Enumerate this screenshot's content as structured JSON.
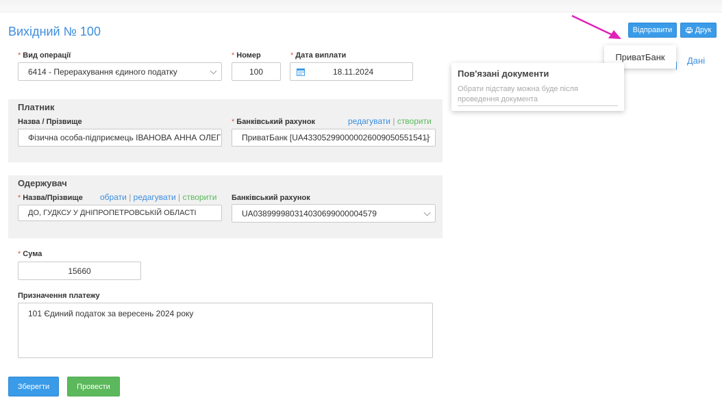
{
  "title": "Вихідний № 100",
  "header_buttons": {
    "send_label": "Відправити",
    "print_label": "Друк"
  },
  "send_dropdown": {
    "items": [
      "ПриватБанк"
    ]
  },
  "tab_link": "Дані",
  "related_docs": {
    "title": "Пов'язані документи",
    "hint": "Обрати підставу можна буде після проведення документа"
  },
  "operation": {
    "label": "Вид операції",
    "value": "6414 - Перерахування єдиного податку"
  },
  "number": {
    "label": "Номер",
    "value": "100"
  },
  "pay_date": {
    "label": "Дата виплати",
    "value": "18.11.2024"
  },
  "payer": {
    "section_title": "Платник",
    "name_label": "Назва / Прізвище",
    "name_value": "Фізична особа-підприємець ІВАНОВА АННА ОЛЕГІВНА",
    "account_label": "Банківський рахунок",
    "account_value": "ПриватБанк [UA433052990000026009050551541]",
    "edit_link": "редагувати",
    "separator": "|",
    "create_link": "створити"
  },
  "recipient": {
    "section_title": "Одержувач",
    "name_label": "Назва/Прізвище",
    "name_value": "ДО, ГУДКСУ У ДНІПРОПЕТРОВСЬКІЙ ОБЛАСТІ",
    "select_link": "обрати",
    "edit_link": "редагувати",
    "create_link": "створити",
    "separator": "|",
    "account_label": "Банківський рахунок",
    "account_value": "UA038999980314030699000004579"
  },
  "sum": {
    "label": "Сума",
    "value": "15660"
  },
  "purpose": {
    "label": "Призначення платежу",
    "value": "101 Єдиний податок за вересень 2024 року"
  },
  "footer_buttons": {
    "save_label": "Зберегти",
    "post_label": "Провести"
  },
  "colors": {
    "accent": "#3a9be8",
    "success": "#5cb85c",
    "required": "#d9534f",
    "arrow": "#e020b8"
  }
}
